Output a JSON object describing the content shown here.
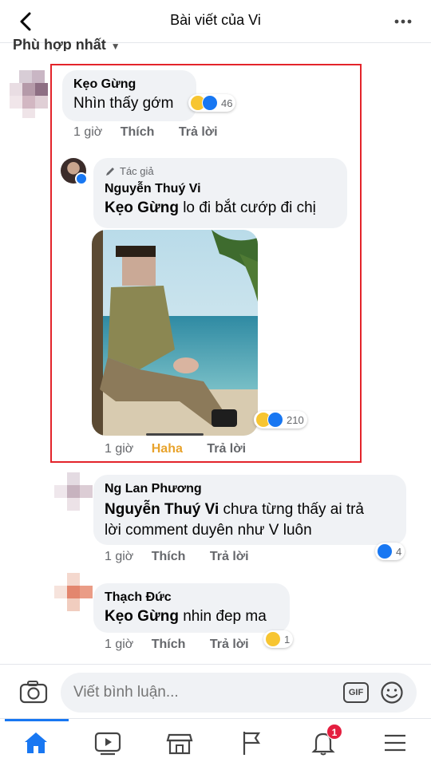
{
  "header": {
    "title": "Bài viết của Vi"
  },
  "sort": {
    "label": "Phù hợp nhất"
  },
  "comments": [
    {
      "name": "Kẹo Gừng",
      "text": "Nhìn thấy gớm",
      "time": "1 giờ",
      "like_label": "Thích",
      "reply_label": "Trả lời",
      "reaction_count": "46",
      "reply": {
        "author_tag": "Tác giả",
        "name": "Nguyễn Thuý Vi",
        "mention": "Kẹo Gừng",
        "text": " lo đi bắt cướp đi chị",
        "time": "1 giờ",
        "like_label": "Haha",
        "reply_label": "Trả lời",
        "reaction_count": "210"
      }
    },
    {
      "name": "Ng Lan Phương",
      "mention": "Nguyễn Thuý Vi",
      "text_line1": "  chưa từng thấy ai trả",
      "text_line2": "lời comment duyên như V luôn",
      "time": "1 giờ",
      "like_label": "Thích",
      "reply_label": "Trả lời",
      "reaction_count": "4"
    },
    {
      "name": "Thạch Đức",
      "mention": "Kẹo Gừng",
      "text": " nhin đep ma",
      "time": "1 giờ",
      "like_label": "Thích",
      "reply_label": "Trả lời",
      "reaction_count": "1"
    }
  ],
  "composer": {
    "placeholder": "Viết bình luận...",
    "gif_label": "GIF"
  },
  "tabbar": {
    "notification_badge": "1"
  },
  "colors": {
    "accent": "#1877f2",
    "highlight_border": "#e3242b",
    "haha": "#e8a32c",
    "badge": "#e41e3f"
  }
}
